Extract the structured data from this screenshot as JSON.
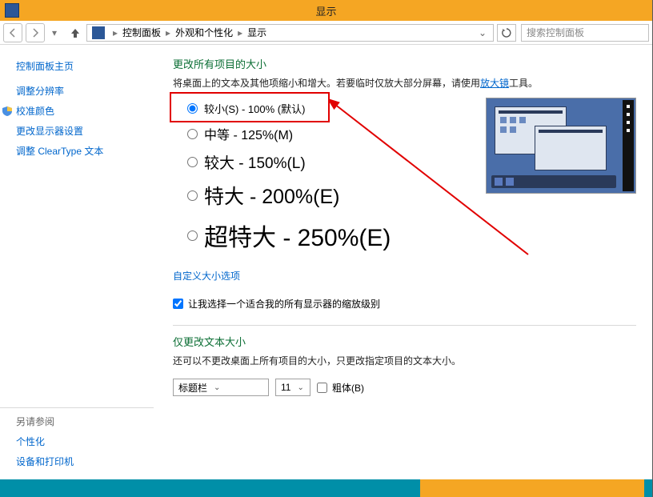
{
  "window": {
    "title": "显示"
  },
  "breadcrumb": {
    "root_icon": "control-panel-icon",
    "items": [
      "控制面板",
      "外观和个性化",
      "显示"
    ]
  },
  "search": {
    "placeholder": "搜索控制面板"
  },
  "sidebar": {
    "home": "控制面板主页",
    "links": [
      "调整分辨率",
      "校准颜色",
      "更改显示器设置",
      "调整 ClearType 文本"
    ],
    "see_also_label": "另请参阅",
    "see_also": [
      "个性化",
      "设备和打印机"
    ]
  },
  "main": {
    "heading": "更改所有项目的大小",
    "desc_pre": "将桌面上的文本及其他项缩小和增大。若要临时仅放大部分屏幕，请使用",
    "desc_link": "放大镜",
    "desc_post": "工具。",
    "options": [
      "较小(S) - 100% (默认)",
      "中等 - 125%(M)",
      "较大 - 150%(L)",
      "特大 - 200%(E)",
      "超特大 - 250%(E)"
    ],
    "selected_index": 0,
    "custom_link": "自定义大小选项",
    "checkbox_label": "让我选择一个适合我的所有显示器的缩放级别",
    "checkbox_checked": true,
    "heading2": "仅更改文本大小",
    "desc2": "还可以不更改桌面上所有项目的大小，只更改指定项目的文本大小。",
    "text_item": {
      "value": "标题栏",
      "options": [
        "标题栏"
      ]
    },
    "text_size": {
      "value": "11",
      "options": [
        "11"
      ]
    },
    "bold_label": "粗体(B)"
  }
}
